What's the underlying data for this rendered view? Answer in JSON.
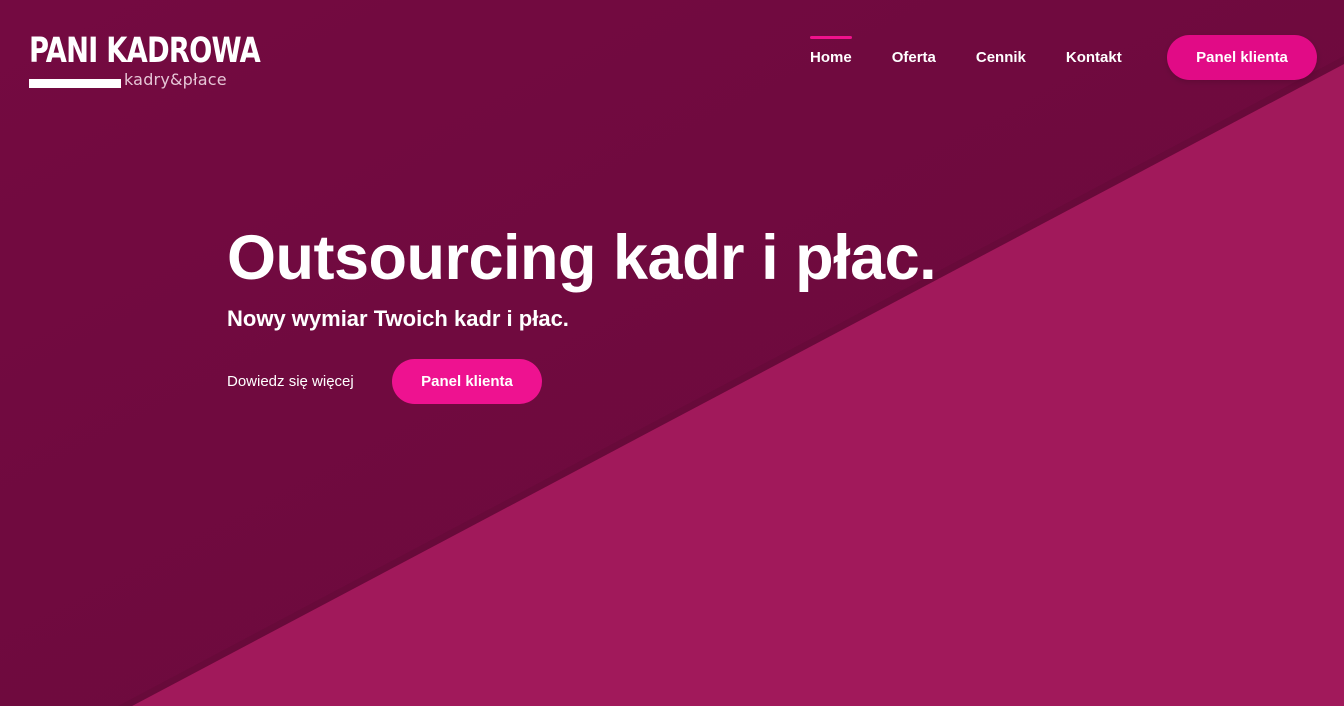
{
  "colors": {
    "background_dark": "#710a40",
    "background_diagonal": "#a1195b",
    "accent": "#ee1290",
    "nav_cta": "#e10b86"
  },
  "logo": {
    "title": "PANI KADROWA",
    "subtitle": "kadry&płace"
  },
  "nav": {
    "items": [
      {
        "label": "Home",
        "active": true
      },
      {
        "label": "Oferta",
        "active": false
      },
      {
        "label": "Cennik",
        "active": false
      },
      {
        "label": "Kontakt",
        "active": false
      }
    ],
    "cta_label": "Panel klienta"
  },
  "hero": {
    "title": "Outsourcing kadr i płac.",
    "subtitle": "Nowy wymiar Twoich kadr i płac.",
    "learn_more_label": "Dowiedz się więcej",
    "cta_label": "Panel klienta"
  }
}
